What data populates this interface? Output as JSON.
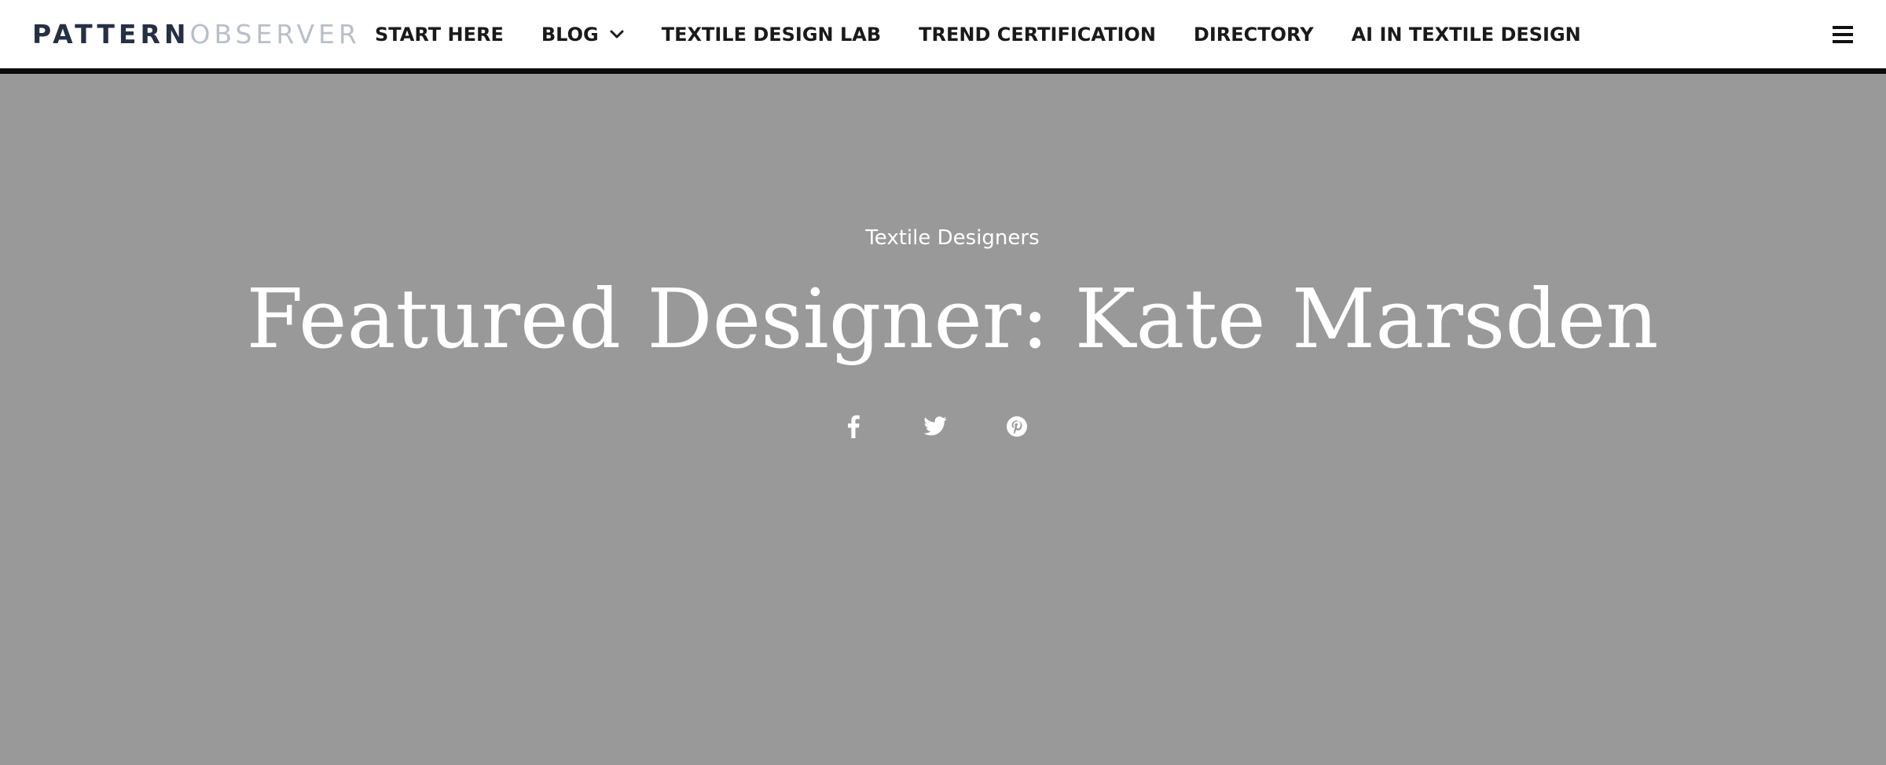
{
  "header": {
    "logo": {
      "part1": "PATTERN",
      "part2": "OBSERVER"
    },
    "nav": [
      {
        "label": "START HERE"
      },
      {
        "label": "BLOG",
        "has_dropdown": true
      },
      {
        "label": "TEXTILE DESIGN LAB"
      },
      {
        "label": "TREND CERTIFICATION"
      },
      {
        "label": "DIRECTORY"
      },
      {
        "label": "AI IN TEXTILE DESIGN"
      }
    ],
    "menu_icon": "hamburger-icon"
  },
  "hero": {
    "category": "Textile Designers",
    "title": "Featured Designer: Kate Marsden",
    "background_color": "#999999",
    "share": [
      {
        "icon": "facebook-icon"
      },
      {
        "icon": "twitter-icon"
      },
      {
        "icon": "pinterest-icon"
      }
    ]
  },
  "colors": {
    "logo_dark": "#253045",
    "logo_light": "#b9bfc8",
    "nav_text": "#1a1a1a",
    "header_border": "#0b0b0b",
    "hero_text": "#ffffff"
  }
}
